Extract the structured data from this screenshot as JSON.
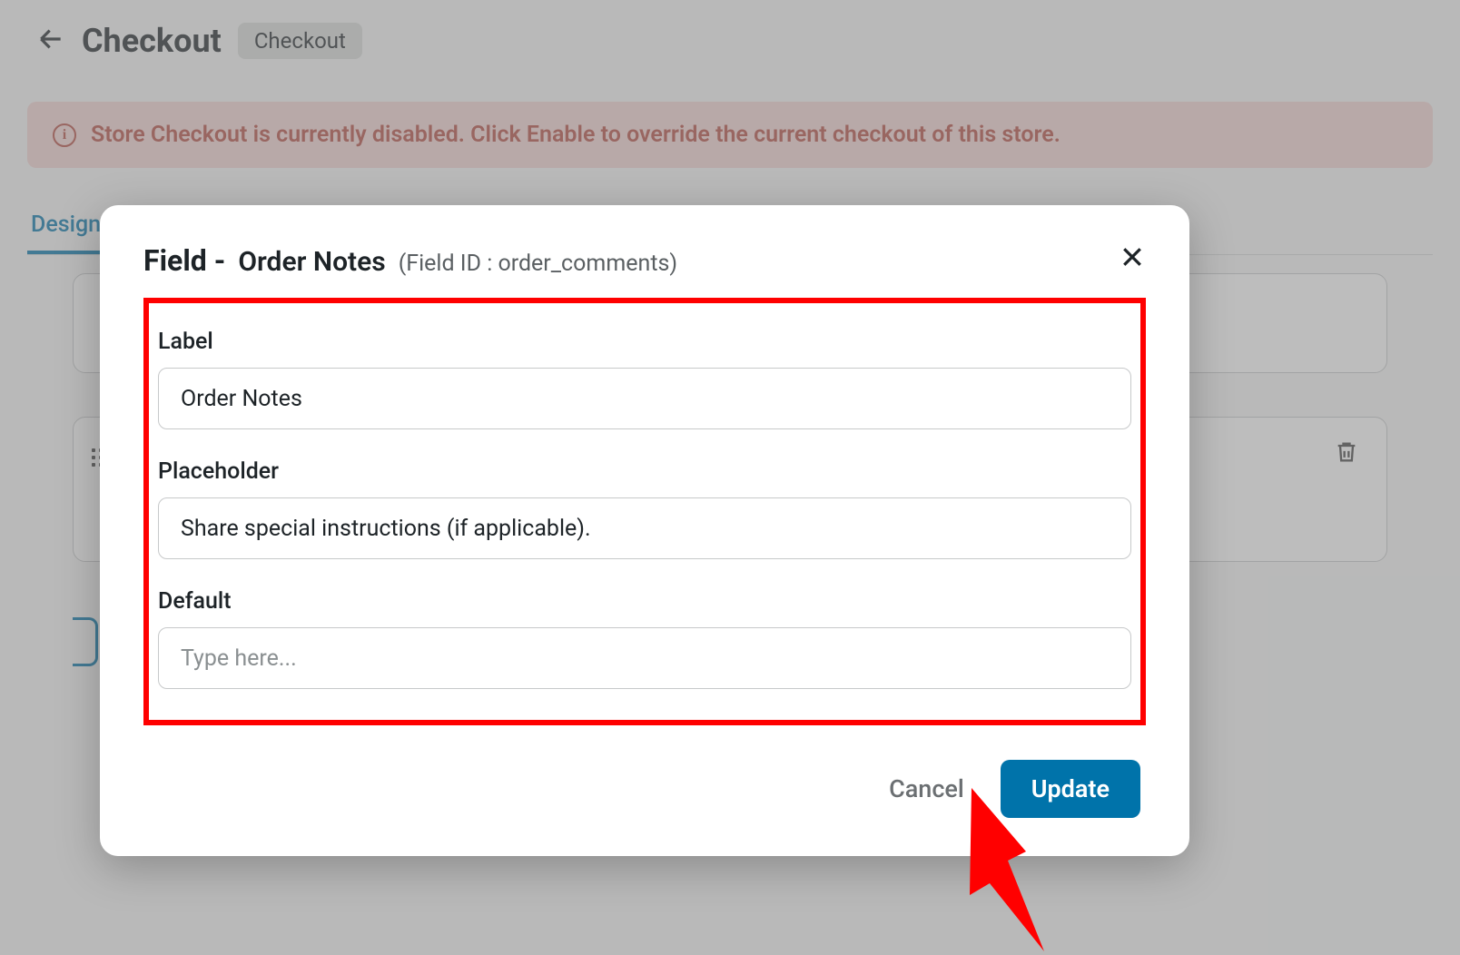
{
  "header": {
    "title": "Checkout",
    "badge": "Checkout"
  },
  "alert": {
    "text": "Store Checkout is currently disabled. Click Enable to override the current checkout of this store."
  },
  "tabs": {
    "active": "Design"
  },
  "modal": {
    "title_prefix": "Field -",
    "title_name": "Order Notes",
    "title_id": "(Field ID : order_comments)",
    "fields": {
      "label": {
        "label": "Label",
        "value": "Order Notes"
      },
      "placeholder": {
        "label": "Placeholder",
        "value": "Share special instructions (if applicable)."
      },
      "default": {
        "label": "Default",
        "value": "",
        "placeholder": "Type here..."
      }
    },
    "buttons": {
      "cancel": "Cancel",
      "update": "Update"
    }
  }
}
